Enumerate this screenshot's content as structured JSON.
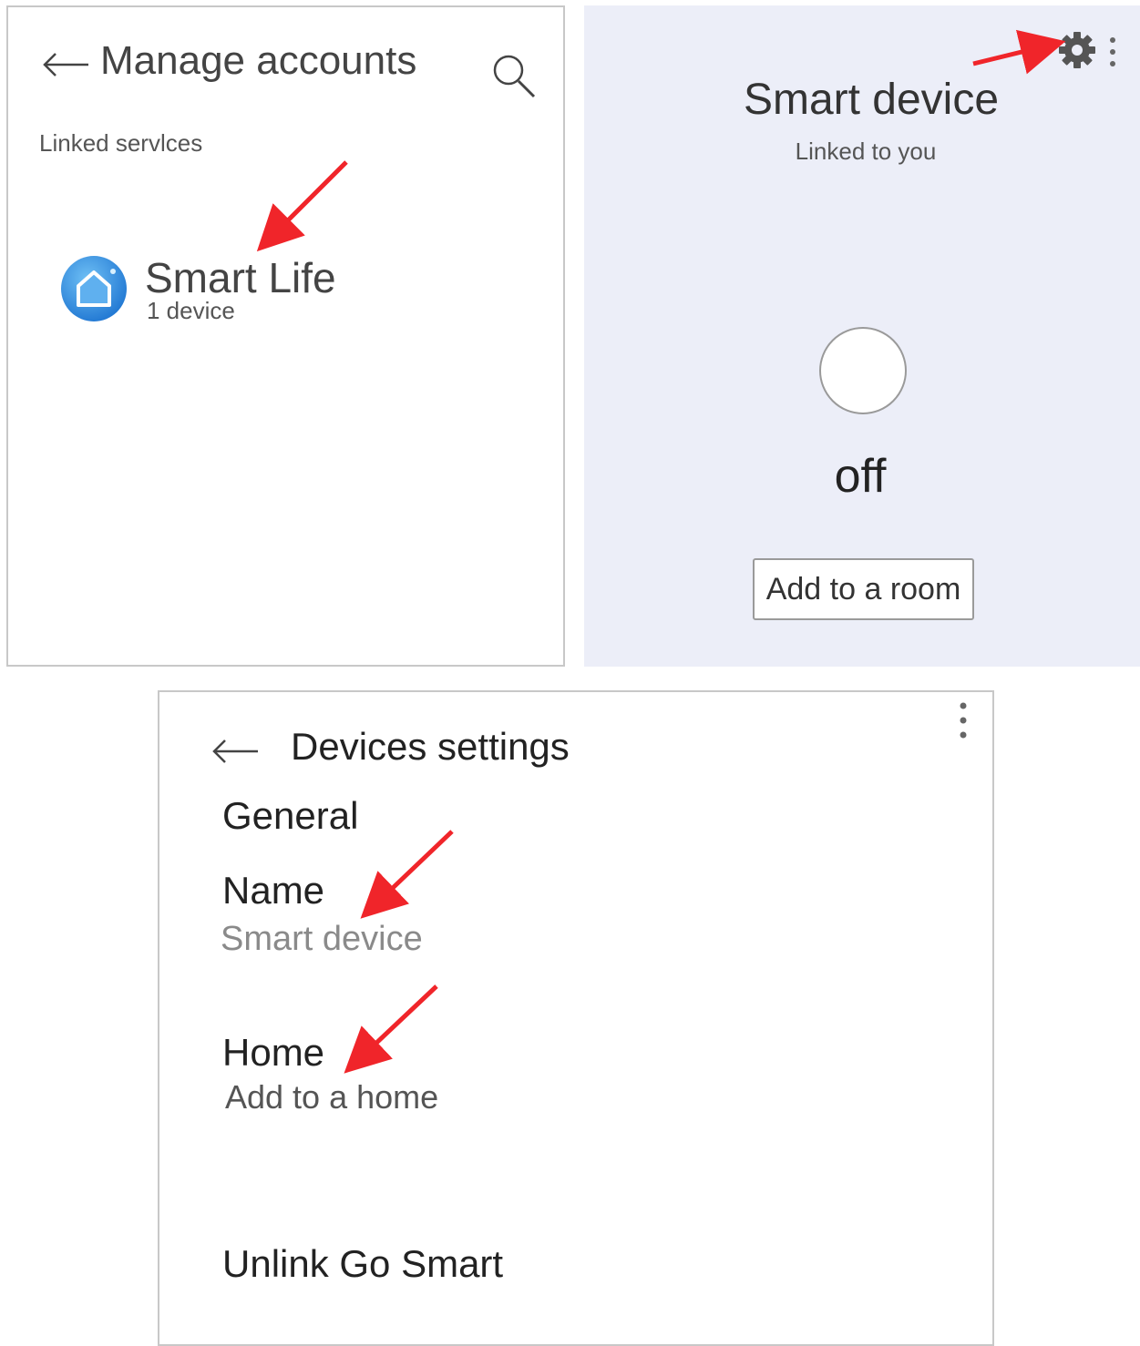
{
  "manage_accounts": {
    "title": "Manage accounts",
    "section_label": "Linked servlces",
    "service": {
      "name": "Smart Life",
      "count": "1 device"
    },
    "icons": [
      "back-arrow-icon",
      "search-icon",
      "smart-life-logo"
    ]
  },
  "device": {
    "title": "Smart device",
    "subtitle": "Linked to you",
    "state": "off",
    "add_room_label": "Add to a room",
    "icons": [
      "gear-icon",
      "more-vert-icon",
      "power-toggle"
    ]
  },
  "settings": {
    "title": "Devices settings",
    "section": "General",
    "name_label": "Name",
    "name_value": "Smart device",
    "home_label": "Home",
    "home_value": "Add to a home",
    "unlink_label": "Unlink Go Smart",
    "icons": [
      "back-arrow-icon",
      "more-vert-icon"
    ]
  },
  "colors": {
    "device_panel_bg": "#eceef8",
    "annotation_arrow": "#f0252a",
    "logo_blue": "#2f8ee0"
  }
}
